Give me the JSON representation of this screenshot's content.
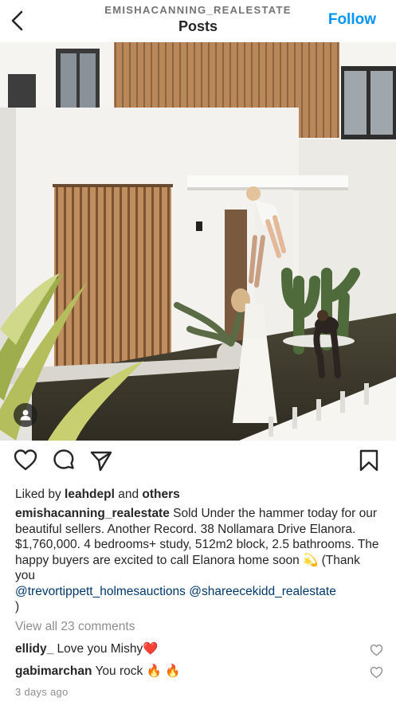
{
  "header": {
    "username": "EMISHACANNING_REALESTATE",
    "title": "Posts",
    "follow_label": "Follow"
  },
  "post": {
    "likes_prefix": "Liked by ",
    "likes_user": "leahdepl",
    "likes_mid": " and ",
    "likes_suffix": "others",
    "caption_user": "emishacanning_realestate",
    "caption_text": " Sold Under the hammer today for our beautiful sellers. Another Record. 38 Nollamara Drive Elanora. $1,760,000. 4 bedrooms+ study, 512m2 block, 2.5 bathrooms. The happy buyers are excited to call Elanora home soon ",
    "caption_emoji": "💫",
    "caption_thanks": " (Thank you",
    "mention_1": "@trevortippett_holmesauctions",
    "mention_2": "@shareecekidd_realestate",
    "caption_close": ")",
    "view_comments": "View all 23 comments",
    "timestamp": "3 days ago"
  },
  "comments": [
    {
      "user": "ellidy_",
      "text": " Love you Mishy",
      "emoji": "❤️"
    },
    {
      "user": "gabimarchan",
      "text": " You rock ",
      "emoji": "🔥 🔥"
    }
  ],
  "icons": {
    "back": "chevron-left-icon",
    "tag": "person-icon",
    "like": "heart-icon",
    "comment": "comment-icon",
    "share": "paper-plane-icon",
    "save": "bookmark-icon",
    "comment_like": "heart-icon"
  },
  "colors": {
    "accent": "#0095f6",
    "mention": "#00376b",
    "muted": "#8e8e8e",
    "text": "#262626"
  }
}
